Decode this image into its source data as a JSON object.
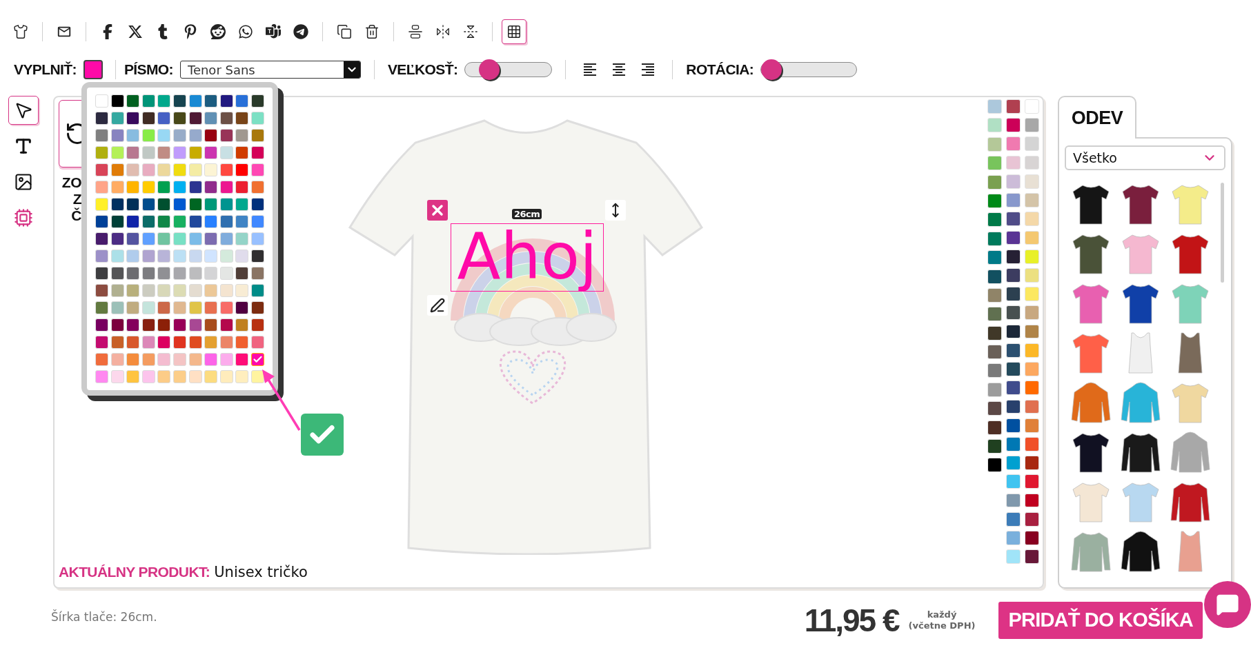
{
  "toolbar": {
    "groups": [
      [
        {
          "kind": "shirt",
          "on": false
        }
      ],
      [
        {
          "kind": "mail",
          "on": false
        }
      ],
      [
        {
          "kind": "facebook",
          "on": false
        },
        {
          "kind": "x",
          "on": false
        },
        {
          "kind": "tumblr",
          "on": false
        },
        {
          "kind": "pinterest",
          "on": false
        },
        {
          "kind": "reddit",
          "on": false
        },
        {
          "kind": "whatsapp",
          "on": false
        },
        {
          "kind": "teams",
          "on": false
        },
        {
          "kind": "telegram",
          "on": false
        }
      ],
      [
        {
          "kind": "copy",
          "on": false
        },
        {
          "kind": "trash",
          "on": false
        }
      ],
      [
        {
          "kind": "center",
          "on": false
        },
        {
          "kind": "flip_h",
          "on": false
        },
        {
          "kind": "flip_v",
          "on": false
        }
      ],
      [
        {
          "kind": "grid",
          "on": true
        }
      ]
    ]
  },
  "format_bar": {
    "fill": {
      "label": "VYPLNIŤ:",
      "color": "#ff0aa8"
    },
    "font": {
      "label": "PÍSMO:",
      "value": "Tenor Sans"
    },
    "size": {
      "label": "VEĽKOSŤ:",
      "level": 0.2
    },
    "alignment": [
      {
        "kind": "left",
        "selected": false
      },
      {
        "kind": "center",
        "selected": false
      },
      {
        "kind": "right",
        "selected": false
      }
    ],
    "rotation": {
      "label": "ROTÁCIA:",
      "level": 0
    }
  },
  "tools": [
    {
      "kind": "select",
      "selected": true
    },
    {
      "kind": "text",
      "selected": false
    },
    {
      "kind": "image",
      "selected": false
    },
    {
      "kind": "ai",
      "selected": false
    }
  ],
  "palette": {
    "rows": [
      [
        {
          "color": "#ffffff",
          "selected": false
        },
        {
          "color": "#000000",
          "selected": false
        },
        {
          "color": "#006020",
          "selected": false
        },
        {
          "color": "#009478",
          "selected": false
        },
        {
          "color": "#00a88c",
          "selected": false
        },
        {
          "color": "#164450",
          "selected": false
        },
        {
          "color": "#1a8ad4",
          "selected": false
        },
        {
          "color": "#1c5c80",
          "selected": false
        },
        {
          "color": "#221a80",
          "selected": false
        },
        {
          "color": "#2870d8",
          "selected": false
        },
        {
          "color": "#2a3a2a",
          "selected": false
        }
      ],
      [
        {
          "color": "#2c2a40",
          "selected": false
        },
        {
          "color": "#34a8a0",
          "selected": false
        },
        {
          "color": "#380a5c",
          "selected": false
        },
        {
          "color": "#402c24",
          "selected": false
        },
        {
          "color": "#4660c4",
          "selected": false
        },
        {
          "color": "#484818",
          "selected": false
        },
        {
          "color": "#501a34",
          "selected": false
        },
        {
          "color": "#6090b4",
          "selected": false
        },
        {
          "color": "#6c5046",
          "selected": false
        },
        {
          "color": "#784418",
          "selected": false
        },
        {
          "color": "#7ce0c4",
          "selected": false
        }
      ],
      [
        {
          "color": "#808080",
          "selected": false
        },
        {
          "color": "#8884c0",
          "selected": false
        },
        {
          "color": "#88bce0",
          "selected": false
        },
        {
          "color": "#88ec48",
          "selected": false
        },
        {
          "color": "#98d8f4",
          "selected": false
        },
        {
          "color": "#98acc8",
          "selected": false
        },
        {
          "color": "#96aacc",
          "selected": false
        },
        {
          "color": "#980010",
          "selected": false
        },
        {
          "color": "#983458",
          "selected": false
        },
        {
          "color": "#a09890",
          "selected": false
        },
        {
          "color": "#a8780c",
          "selected": false
        }
      ],
      [
        {
          "color": "#b0b010",
          "selected": false
        },
        {
          "color": "#b4f058",
          "selected": false
        },
        {
          "color": "#b87890",
          "selected": false
        },
        {
          "color": "#c0c8c4",
          "selected": false
        },
        {
          "color": "#c08c84",
          "selected": false
        },
        {
          "color": "#c09cfc",
          "selected": false
        },
        {
          "color": "#c8ac00",
          "selected": false
        },
        {
          "color": "#cc34b0",
          "selected": false
        },
        {
          "color": "#c8e0e4",
          "selected": false
        },
        {
          "color": "#d03c00",
          "selected": false
        },
        {
          "color": "#d40058",
          "selected": false
        }
      ],
      [
        {
          "color": "#d84458",
          "selected": false
        },
        {
          "color": "#e07c08",
          "selected": false
        },
        {
          "color": "#e0bcb0",
          "selected": false
        },
        {
          "color": "#e8acc0",
          "selected": false
        },
        {
          "color": "#ecd89c",
          "selected": false
        },
        {
          "color": "#f0dc10",
          "selected": false
        },
        {
          "color": "#f4eca4",
          "selected": false
        },
        {
          "color": "#fcf4d4",
          "selected": false
        },
        {
          "color": "#ff4840",
          "selected": false
        },
        {
          "color": "#ff0000",
          "selected": false
        },
        {
          "color": "#ff48b4",
          "selected": false
        }
      ],
      [
        {
          "color": "#ffa488",
          "selected": false
        },
        {
          "color": "#ffac64",
          "selected": false
        },
        {
          "color": "#ffb400",
          "selected": false
        },
        {
          "color": "#ffcc00",
          "selected": false
        },
        {
          "color": "#00a050",
          "selected": false
        },
        {
          "color": "#00b0f0",
          "selected": false
        },
        {
          "color": "#2c3490",
          "selected": false
        },
        {
          "color": "#902c8c",
          "selected": false
        },
        {
          "color": "#ec1890",
          "selected": false
        },
        {
          "color": "#ec2030",
          "selected": false
        },
        {
          "color": "#f07030",
          "selected": false
        }
      ],
      [
        {
          "color": "#fff028",
          "selected": false
        },
        {
          "color": "#003060",
          "selected": false
        },
        {
          "color": "#003058",
          "selected": false
        },
        {
          "color": "#004c8c",
          "selected": false
        },
        {
          "color": "#005030",
          "selected": false
        },
        {
          "color": "#0058d0",
          "selected": false
        },
        {
          "color": "#006622",
          "selected": false
        },
        {
          "color": "#009878",
          "selected": false
        },
        {
          "color": "#009490",
          "selected": false
        },
        {
          "color": "#00a88e",
          "selected": false
        },
        {
          "color": "#00307c",
          "selected": false
        }
      ],
      [
        {
          "color": "#004098",
          "selected": false
        },
        {
          "color": "#004038",
          "selected": false
        },
        {
          "color": "#1024a8",
          "selected": false
        },
        {
          "color": "#0c6c68",
          "selected": false
        },
        {
          "color": "#108848",
          "selected": false
        },
        {
          "color": "#18b060",
          "selected": false
        },
        {
          "color": "#20489c",
          "selected": false
        },
        {
          "color": "#2880ff",
          "selected": false
        },
        {
          "color": "#3070b0",
          "selected": false
        },
        {
          "color": "#4084c4",
          "selected": false
        },
        {
          "color": "#4088ff",
          "selected": false
        }
      ],
      [
        {
          "color": "#481c6c",
          "selected": false
        },
        {
          "color": "#4c2c84",
          "selected": false
        },
        {
          "color": "#5454a0",
          "selected": false
        },
        {
          "color": "#60a0ff",
          "selected": false
        },
        {
          "color": "#70c4a0",
          "selected": false
        },
        {
          "color": "#78e0c4",
          "selected": false
        },
        {
          "color": "#7cbce8",
          "selected": false
        },
        {
          "color": "#7c6cb0",
          "selected": false
        },
        {
          "color": "#80acdc",
          "selected": false
        },
        {
          "color": "#94d4c8",
          "selected": false
        },
        {
          "color": "#98c0ff",
          "selected": false
        }
      ],
      [
        {
          "color": "#9c90c8",
          "selected": false
        },
        {
          "color": "#ace0e8",
          "selected": false
        },
        {
          "color": "#b0ccec",
          "selected": false
        },
        {
          "color": "#b0a4d0",
          "selected": false
        },
        {
          "color": "#b8b4d8",
          "selected": false
        },
        {
          "color": "#bce0f4",
          "selected": false
        },
        {
          "color": "#c8d8f0",
          "selected": false
        },
        {
          "color": "#d0e4ff",
          "selected": false
        },
        {
          "color": "#d4eadc",
          "selected": false
        },
        {
          "color": "#e0dcec",
          "selected": false
        },
        {
          "color": "#302e30",
          "selected": false
        }
      ],
      [
        {
          "color": "#3e3e40",
          "selected": false
        },
        {
          "color": "#545456",
          "selected": false
        },
        {
          "color": "#6c6c70",
          "selected": false
        },
        {
          "color": "#7c7c80",
          "selected": false
        },
        {
          "color": "#909094",
          "selected": false
        },
        {
          "color": "#a8a8ac",
          "selected": false
        },
        {
          "color": "#bcbcbe",
          "selected": false
        },
        {
          "color": "#d4d4d6",
          "selected": false
        },
        {
          "color": "#e4e6e4",
          "selected": false
        },
        {
          "color": "#503e38",
          "selected": false
        },
        {
          "color": "#8a7464",
          "selected": false
        }
      ],
      [
        {
          "color": "#8c4c40",
          "selected": false
        },
        {
          "color": "#b0b090",
          "selected": false
        },
        {
          "color": "#b8b07c",
          "selected": false
        },
        {
          "color": "#ccccc0",
          "selected": false
        },
        {
          "color": "#d8d8b8",
          "selected": false
        },
        {
          "color": "#dcdcb4",
          "selected": false
        },
        {
          "color": "#e4dcd0",
          "selected": false
        },
        {
          "color": "#ecc898",
          "selected": false
        },
        {
          "color": "#f4e4d0",
          "selected": false
        },
        {
          "color": "#f8ecd4",
          "selected": false
        },
        {
          "color": "#008c88",
          "selected": false
        }
      ],
      [
        {
          "color": "#627a40",
          "selected": false
        },
        {
          "color": "#9cc0b8",
          "selected": false
        },
        {
          "color": "#c0ac80",
          "selected": false
        },
        {
          "color": "#c4e4dc",
          "selected": false
        },
        {
          "color": "#cc6848",
          "selected": false
        },
        {
          "color": "#e0b890",
          "selected": false
        },
        {
          "color": "#e0c448",
          "selected": false
        },
        {
          "color": "#e87050",
          "selected": false
        },
        {
          "color": "#f86c68",
          "selected": false
        },
        {
          "color": "#500040",
          "selected": false
        },
        {
          "color": "#7c2c10",
          "selected": false
        }
      ],
      [
        {
          "color": "#780060",
          "selected": false
        },
        {
          "color": "#7c003c",
          "selected": false
        },
        {
          "color": "#84005c",
          "selected": false
        },
        {
          "color": "#882010",
          "selected": false
        },
        {
          "color": "#8c2008",
          "selected": false
        },
        {
          "color": "#980058",
          "selected": false
        },
        {
          "color": "#a84894",
          "selected": false
        },
        {
          "color": "#a84c1c",
          "selected": false
        },
        {
          "color": "#b4084c",
          "selected": false
        },
        {
          "color": "#c08020",
          "selected": false
        },
        {
          "color": "#b83010",
          "selected": false
        }
      ],
      [
        {
          "color": "#c40c70",
          "selected": false
        },
        {
          "color": "#c86028",
          "selected": false
        },
        {
          "color": "#d8582c",
          "selected": false
        },
        {
          "color": "#dc88b8",
          "selected": false
        },
        {
          "color": "#dc0060",
          "selected": false
        },
        {
          "color": "#e03420",
          "selected": false
        },
        {
          "color": "#e04c20",
          "selected": false
        },
        {
          "color": "#e4a030",
          "selected": false
        },
        {
          "color": "#ec8468",
          "selected": false
        },
        {
          "color": "#f06030",
          "selected": false
        },
        {
          "color": "#f06480",
          "selected": false
        }
      ],
      [
        {
          "color": "#f06c3c",
          "selected": false
        },
        {
          "color": "#f4b0a0",
          "selected": false
        },
        {
          "color": "#f48c3c",
          "selected": false
        },
        {
          "color": "#f49c60",
          "selected": false
        },
        {
          "color": "#f4bcd0",
          "selected": false
        },
        {
          "color": "#f4c4c4",
          "selected": false
        },
        {
          "color": "#f4b88c",
          "selected": false
        },
        {
          "color": "#fc64e8",
          "selected": false
        },
        {
          "color": "#fcacec",
          "selected": false
        },
        {
          "color": "#ff0c78",
          "selected": false
        },
        {
          "color": "#ff0aa8",
          "selected": true
        }
      ],
      [
        {
          "color": "#ff88f0",
          "selected": false
        },
        {
          "color": "#fcd8ec",
          "selected": false
        },
        {
          "color": "#ffc440",
          "selected": false
        },
        {
          "color": "#fcc4ec",
          "selected": false
        },
        {
          "color": "#fccc88",
          "selected": false
        },
        {
          "color": "#fcce8a",
          "selected": false
        },
        {
          "color": "#ffe0c4",
          "selected": false
        },
        {
          "color": "#fcdc80",
          "selected": false
        },
        {
          "color": "#ffecbc",
          "selected": false
        },
        {
          "color": "#ffeebe",
          "selected": false
        },
        {
          "color": "#fff4a0",
          "selected": false
        }
      ]
    ]
  },
  "view_card": {
    "lines": [
      "ZO",
      "Z",
      "Č"
    ]
  },
  "design": {
    "width_label": "26cm",
    "text": "Ahoj"
  },
  "garment_colors": {
    "columns": [
      [
        {
          "color": "#acc8dc",
          "selected": false
        },
        {
          "color": "#b0e0c4",
          "selected": false
        },
        {
          "color": "#b4c898",
          "selected": false
        },
        {
          "color": "#78c45c",
          "selected": false
        },
        {
          "color": "#7aa050",
          "selected": false
        },
        {
          "color": "#008a18",
          "selected": false
        },
        {
          "color": "#007a48",
          "selected": false
        },
        {
          "color": "#007a5c",
          "selected": false
        },
        {
          "color": "#007a88",
          "selected": false
        },
        {
          "color": "#125060",
          "selected": false
        },
        {
          "color": "#908468",
          "selected": false
        },
        {
          "color": "#607050",
          "selected": false
        },
        {
          "color": "#403828",
          "selected": false
        },
        {
          "color": "#6a6058",
          "selected": false
        },
        {
          "color": "#7a7a7a",
          "selected": false
        },
        {
          "color": "#9c9c9c",
          "selected": false
        },
        {
          "color": "#5c4846",
          "selected": false
        },
        {
          "color": "#4e2e24",
          "selected": false
        },
        {
          "color": "#204020",
          "selected": false
        },
        {
          "color": "#000000",
          "selected": false
        }
      ],
      [
        {
          "color": "#b04050",
          "selected": false
        },
        {
          "color": "#cc0058",
          "selected": false
        },
        {
          "color": "#f07ab0",
          "selected": false
        },
        {
          "color": "#e8c4d4",
          "selected": false
        },
        {
          "color": "#ccbcd8",
          "selected": false
        },
        {
          "color": "#8898cc",
          "selected": false
        },
        {
          "color": "#504c88",
          "selected": false
        },
        {
          "color": "#5a3494",
          "selected": false
        },
        {
          "color": "#262034",
          "selected": false
        },
        {
          "color": "#3c3c60",
          "selected": false
        },
        {
          "color": "#2c4050",
          "selected": false
        },
        {
          "color": "#485050",
          "selected": false
        },
        {
          "color": "#1c2838",
          "selected": false
        },
        {
          "color": "#2c5070",
          "selected": false
        },
        {
          "color": "#244a5c",
          "selected": false
        },
        {
          "color": "#404c8c",
          "selected": false
        },
        {
          "color": "#28406c",
          "selected": false
        },
        {
          "color": "#0050a0",
          "selected": false
        },
        {
          "color": "#0078b4",
          "selected": false
        },
        {
          "color": "#00a0d0",
          "selected": false
        },
        {
          "color": "#40c4f0",
          "selected": false
        },
        {
          "color": "#8098ac",
          "selected": false
        },
        {
          "color": "#3c7cb8",
          "selected": false
        },
        {
          "color": "#7ab0dc",
          "selected": false
        },
        {
          "color": "#a0e4f8",
          "selected": false
        }
      ],
      [
        {
          "color": "#ffffff",
          "selected": false
        },
        {
          "color": "#a8a8a8",
          "selected": false
        },
        {
          "color": "#d4d4d4",
          "selected": false
        },
        {
          "color": "#d8d4d4",
          "selected": false
        },
        {
          "color": "#e8e0d4",
          "selected": false
        },
        {
          "color": "#d4c4a8",
          "selected": false
        },
        {
          "color": "#f4d8a8",
          "selected": false
        },
        {
          "color": "#f4c870",
          "selected": false
        },
        {
          "color": "#e8f028",
          "selected": false
        },
        {
          "color": "#ece080",
          "selected": false
        },
        {
          "color": "#fce860",
          "selected": false
        },
        {
          "color": "#c8a880",
          "selected": false
        },
        {
          "color": "#b08448",
          "selected": false
        },
        {
          "color": "#fcb828",
          "selected": false
        },
        {
          "color": "#fca860",
          "selected": false
        },
        {
          "color": "#ff6a00",
          "selected": false
        },
        {
          "color": "#e07050",
          "selected": false
        },
        {
          "color": "#e08038",
          "selected": false
        },
        {
          "color": "#f05028",
          "selected": false
        },
        {
          "color": "#a82810",
          "selected": false
        },
        {
          "color": "#e01830",
          "selected": false
        },
        {
          "color": "#c00020",
          "selected": false
        },
        {
          "color": "#a82040",
          "selected": false
        },
        {
          "color": "#880020",
          "selected": false
        },
        {
          "color": "#681838",
          "selected": false
        }
      ]
    ]
  },
  "current_product": {
    "label": "AKTUÁLNY PRODUKT:",
    "name": "Unisex tričko"
  },
  "catalog": {
    "tab": {
      "label": "ODEV",
      "selected": true
    },
    "filter": {
      "value": "Všetko"
    },
    "items": [
      {
        "kind": "tshirt",
        "color": "#151515",
        "selected": false
      },
      {
        "kind": "tshirt",
        "color": "#7a1f3d",
        "selected": false
      },
      {
        "kind": "tshirt",
        "color": "#f4ec8a",
        "selected": false
      },
      {
        "kind": "tshirt",
        "color": "#4a5238",
        "selected": false
      },
      {
        "kind": "tshirt",
        "color": "#f5b8d0",
        "selected": false
      },
      {
        "kind": "tshirt",
        "color": "#c21416",
        "selected": false
      },
      {
        "kind": "tshirt",
        "color": "#e860b0",
        "selected": false
      },
      {
        "kind": "tshirt",
        "color": "#1040a8",
        "selected": false
      },
      {
        "kind": "tshirt",
        "color": "#7ed3b8",
        "selected": false
      },
      {
        "kind": "tshirt",
        "color": "#ff6048",
        "selected": false
      },
      {
        "kind": "tank",
        "color": "#f0f0f0",
        "selected": false
      },
      {
        "kind": "tank",
        "color": "#7a6a5a",
        "selected": false
      },
      {
        "kind": "hoodie",
        "color": "#e06a1a",
        "selected": false
      },
      {
        "kind": "hoodie",
        "color": "#28b4d8",
        "selected": false
      },
      {
        "kind": "tshirt",
        "color": "#f0d8a0",
        "selected": false
      },
      {
        "kind": "tshirt",
        "color": "#111122",
        "selected": false
      },
      {
        "kind": "longsleeve",
        "color": "#1a1a1a",
        "selected": false
      },
      {
        "kind": "hoodie",
        "color": "#a8a8a8",
        "selected": false
      },
      {
        "kind": "tshirt",
        "color": "#f4e6d4",
        "selected": false
      },
      {
        "kind": "tshirt",
        "color": "#b8d8f0",
        "selected": false
      },
      {
        "kind": "longsleeve",
        "color": "#c01820",
        "selected": false
      },
      {
        "kind": "longsleeve",
        "color": "#9ab0a0",
        "selected": false
      },
      {
        "kind": "hoodie",
        "color": "#111111",
        "selected": false
      },
      {
        "kind": "tank",
        "color": "#e8a090",
        "selected": false
      }
    ]
  },
  "footer": {
    "print_width": "Šírka tlače: 26cm.",
    "price": "11,95 €",
    "price_note": [
      "každý",
      "(včetne DPH)"
    ],
    "cart_button": "PRIDAŤ DO KOŠÍKA"
  }
}
